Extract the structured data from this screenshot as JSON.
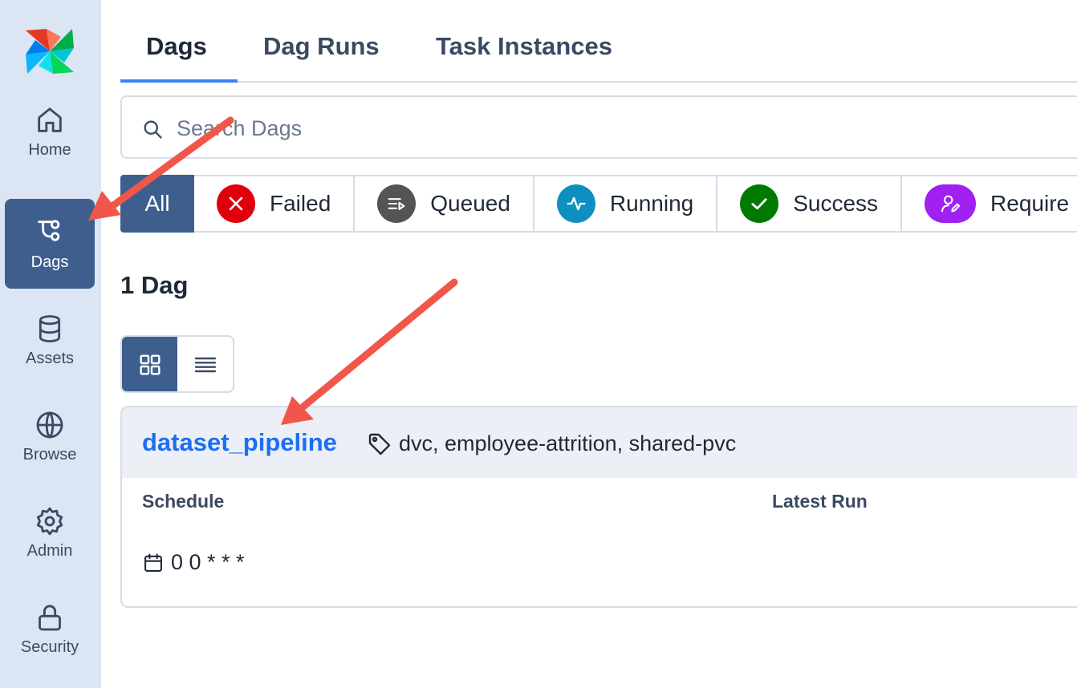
{
  "sidebar": {
    "items": [
      {
        "label": "Home",
        "icon": "home-icon"
      },
      {
        "label": "Dags",
        "icon": "dags-icon",
        "active": true
      },
      {
        "label": "Assets",
        "icon": "database-icon"
      },
      {
        "label": "Browse",
        "icon": "globe-icon"
      },
      {
        "label": "Admin",
        "icon": "gear-icon"
      },
      {
        "label": "Security",
        "icon": "lock-icon"
      }
    ]
  },
  "tabs": [
    {
      "label": "Dags",
      "active": true
    },
    {
      "label": "Dag Runs"
    },
    {
      "label": "Task Instances"
    }
  ],
  "search": {
    "placeholder": "Search Dags",
    "value": ""
  },
  "filters": [
    {
      "label": "All",
      "active": true
    },
    {
      "label": "Failed",
      "color": "#e0000d"
    },
    {
      "label": "Queued",
      "color": "#545454"
    },
    {
      "label": "Running",
      "color": "#0e8fbf"
    },
    {
      "label": "Success",
      "color": "#007a00"
    },
    {
      "label": "Require",
      "color": "#a020f0"
    }
  ],
  "dag_count": "1 Dag",
  "dag": {
    "name": "dataset_pipeline",
    "tags": "dvc, employee-attrition, shared-pvc",
    "schedule_label": "Schedule",
    "latest_run_label": "Latest Run",
    "schedule": "0 0 * * *"
  },
  "colors": {
    "accent": "#3e5f8e",
    "link": "#1d6ef5",
    "annotation_arrow": "#f0574a"
  }
}
